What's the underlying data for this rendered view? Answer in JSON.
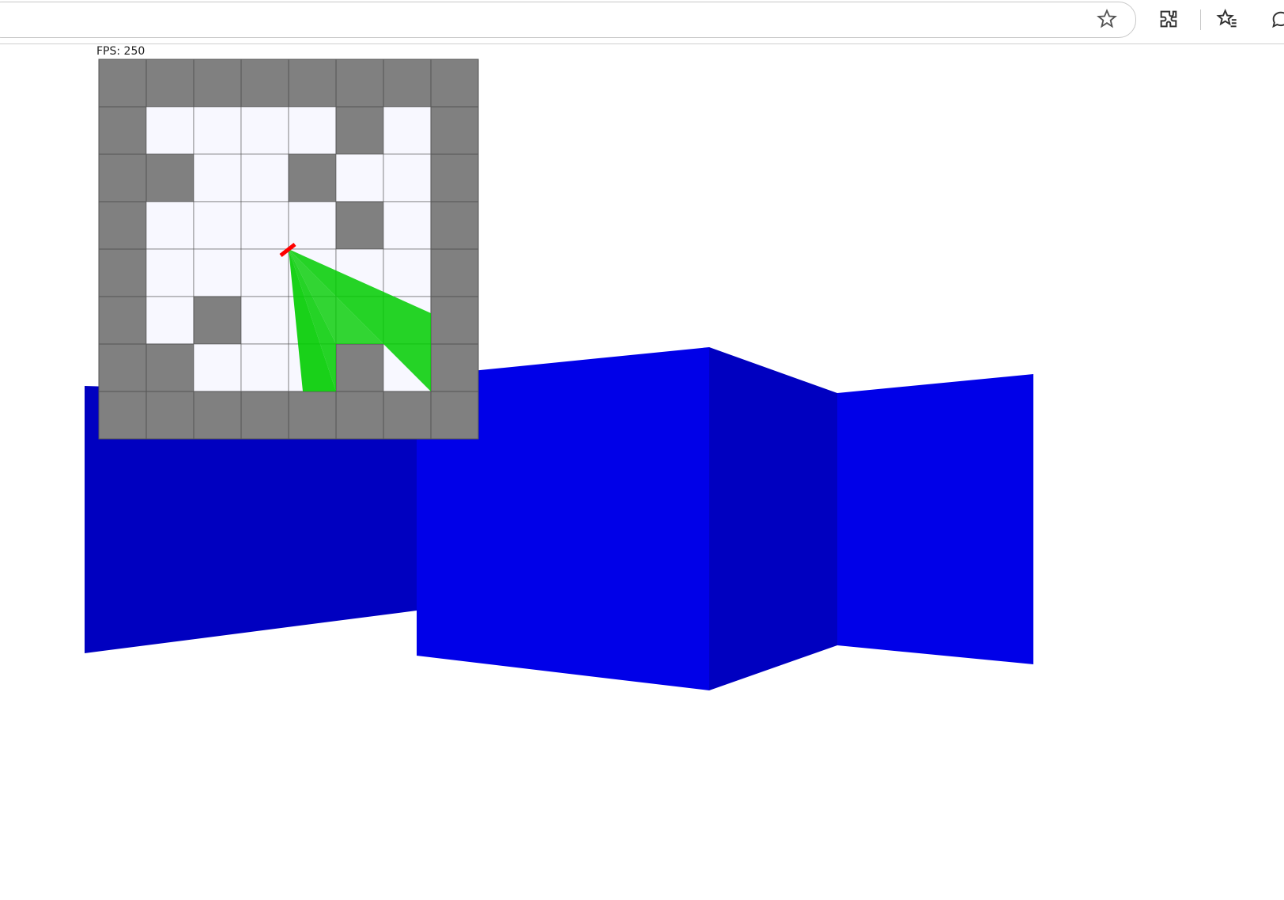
{
  "toolbar": {
    "icons": [
      "star-icon",
      "extensions-icon",
      "favorites-icon",
      "chat-icon"
    ]
  },
  "hud": {
    "fps_label": "FPS: 250"
  },
  "minimap": {
    "grid": [
      [
        1,
        1,
        1,
        1,
        1,
        1,
        1,
        1
      ],
      [
        1,
        0,
        0,
        0,
        0,
        1,
        0,
        1
      ],
      [
        1,
        1,
        0,
        0,
        1,
        0,
        0,
        1
      ],
      [
        1,
        0,
        0,
        0,
        0,
        1,
        0,
        1
      ],
      [
        1,
        0,
        0,
        0,
        0,
        0,
        0,
        1
      ],
      [
        1,
        0,
        1,
        0,
        0,
        0,
        0,
        1
      ],
      [
        1,
        1,
        0,
        0,
        0,
        1,
        0,
        1
      ],
      [
        1,
        1,
        1,
        1,
        1,
        1,
        1,
        1
      ]
    ],
    "colors": {
      "wall": "#808080",
      "floor": "#f8f8ff",
      "grid_line": "#555555",
      "player": "#ff0000",
      "rays": "#00cc00"
    },
    "player": {
      "col": 4.0,
      "row": 4.0
    },
    "ray_hits": [
      {
        "col": 4.3,
        "row": 7.0
      },
      {
        "col": 5.0,
        "row": 7.0
      },
      {
        "col": 5.0,
        "row": 6.0
      },
      {
        "col": 6.0,
        "row": 6.0
      },
      {
        "col": 7.0,
        "row": 7.0
      },
      {
        "col": 7.0,
        "row": 5.35
      }
    ]
  },
  "scene": {
    "colors": {
      "wall_light": "#0000e8",
      "wall_dark": "#0000c0"
    }
  }
}
